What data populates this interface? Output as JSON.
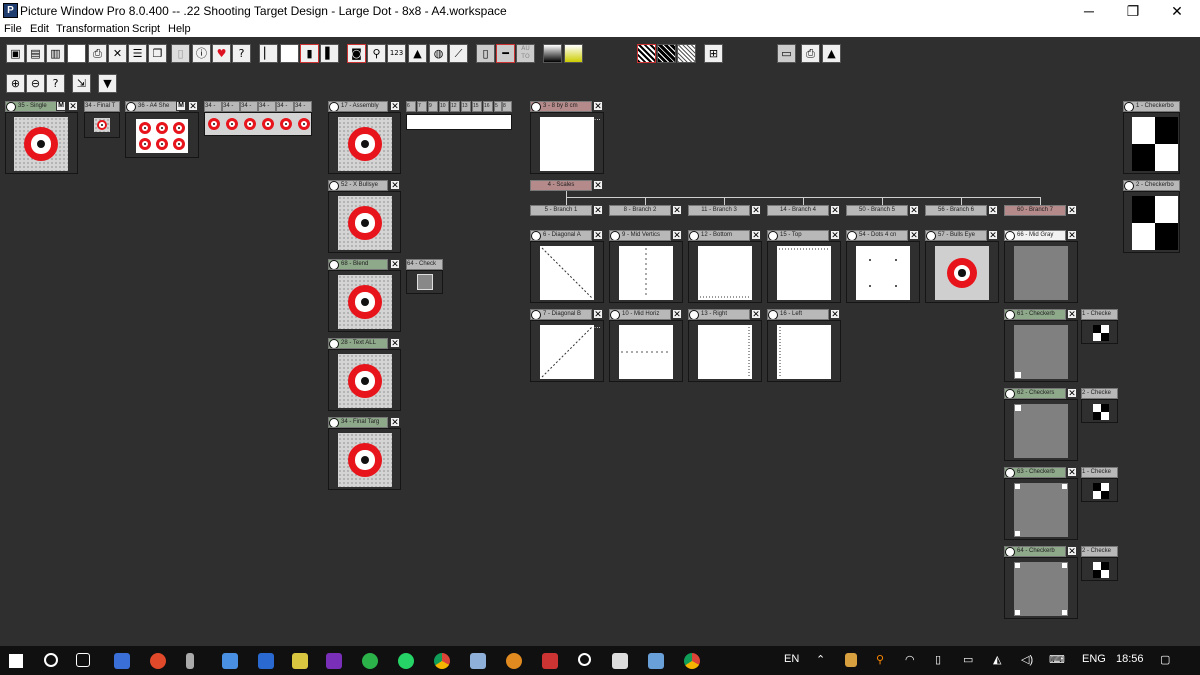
{
  "window": {
    "title": "Picture Window Pro 8.0.400  --  .22 Shooting Target Design - Large Dot - 8x8 - A4.workspace",
    "minimize": "─",
    "maximize": "❐",
    "close": "✕"
  },
  "menu": [
    "File",
    "Edit",
    "Transformation",
    "Script",
    "Help"
  ],
  "toolbar2": {
    "zoom_in": "⊕",
    "zoom_out": "⊖",
    "help": "?",
    "fit": "⇲",
    "dropdown": "▼"
  },
  "toolbar1": {
    "count_label": "123"
  },
  "nodes": {
    "n35": "35 - Single",
    "n34a": "34 - Final T",
    "n36": "36 - A4 She",
    "n34row": [
      "34 - ",
      "34 - ",
      "34 - ",
      "34 - ",
      "34 - ",
      "34 - "
    ],
    "n17": "17 - Assembly",
    "n17cols": [
      "6",
      "7",
      "9",
      "10",
      "12",
      "13",
      "15",
      "16",
      "5",
      "8"
    ],
    "n52": "52 - X Bullsye",
    "n68": "68 - Blend",
    "n64": "64 - Check",
    "n28": "28 - Text ALL",
    "n34b": "34 - Final Targ",
    "n3": "3 - 8 by 8 cm",
    "n4": "4 - Scales",
    "branches": [
      "5 - Branch 1",
      "8 - Branch 2",
      "11 - Branch 3",
      "14 - Branch 4",
      "50 - Branch 5",
      "56 - Branch 6",
      "60 - Branch 7"
    ],
    "row1": [
      "6 - Diagonal A",
      "9 - Mid Vertics",
      "12 - Bottom",
      "15 - Top",
      "54 - Dots 4 cn",
      "57 - Bulls Eye",
      "66 - Mid Gray"
    ],
    "row2": [
      "7 - Diagonal B",
      "10 - Mid Horiz",
      "13 - Right",
      "16 - Left"
    ],
    "checkers": [
      "61 - Checkerb",
      "62 - Checkers",
      "63 - Checkerb",
      "64 - Checkerb"
    ],
    "checkers_side": [
      "1 - Checke",
      "2 - Checke",
      "1 - Checke",
      "2 - Checke"
    ],
    "right_top": [
      "1 - Checkerbo",
      "2 - Checkerbo"
    ],
    "m_label": "M",
    "x_label": "✕",
    "more": "..."
  },
  "taskbar": {
    "lang": "EN",
    "lang2": "ENG",
    "time": "18:56"
  }
}
